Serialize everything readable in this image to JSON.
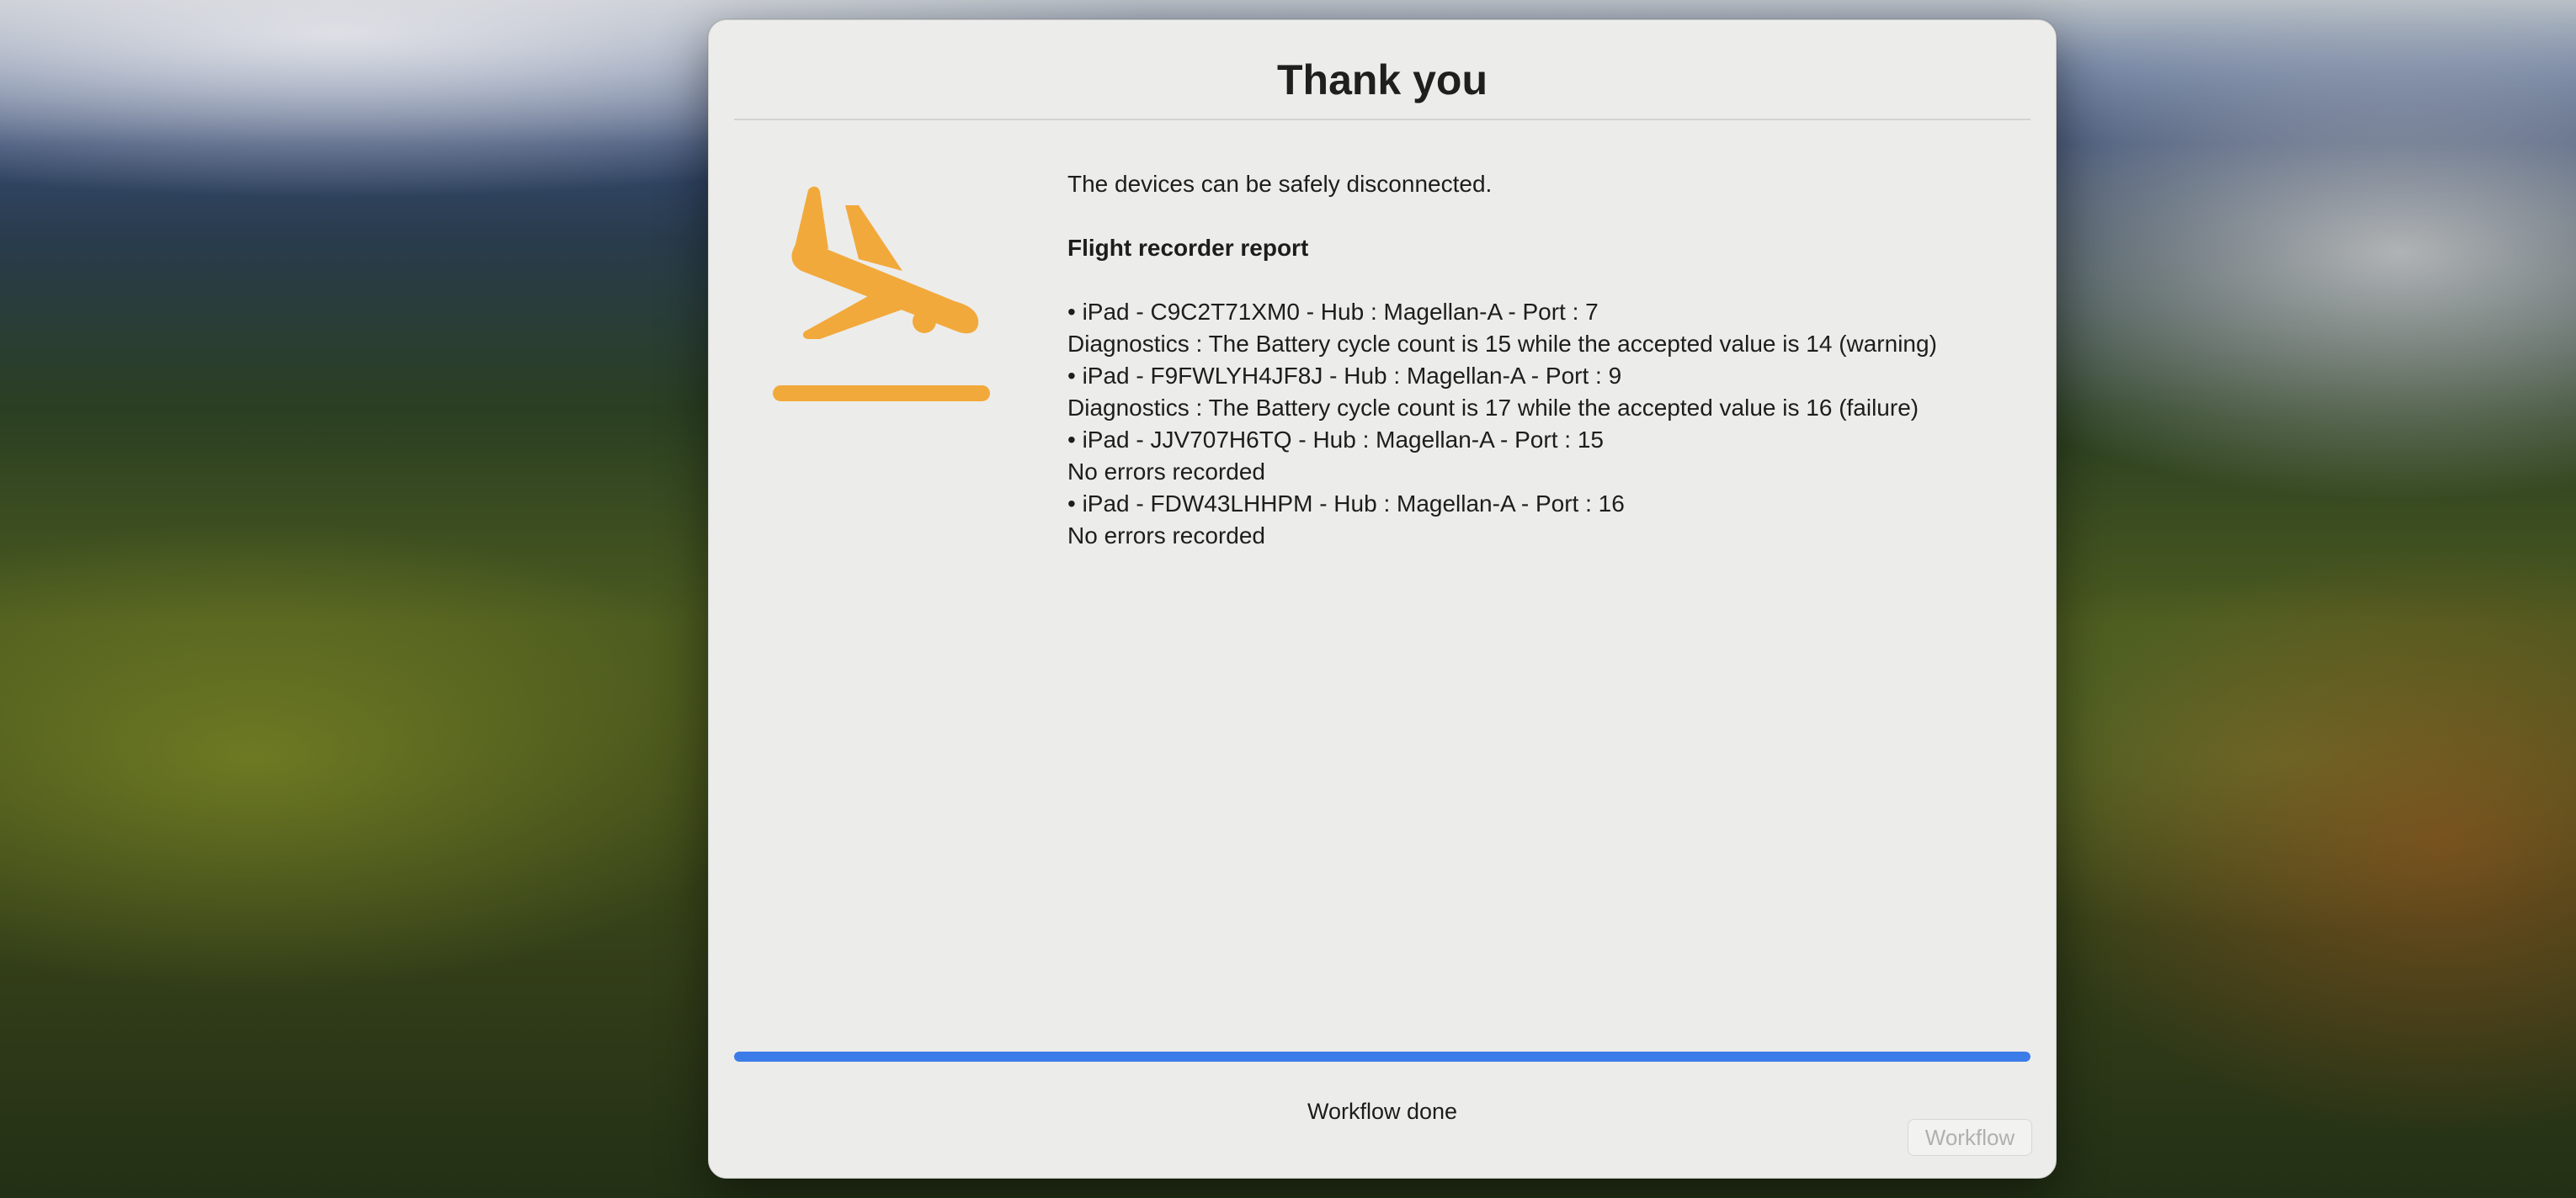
{
  "window": {
    "title": "Thank you"
  },
  "icon": {
    "name": "airplane-arrival-icon",
    "color": "#f2a93b"
  },
  "message": {
    "intro": "The devices can be safely disconnected.",
    "report_heading": "Flight recorder report",
    "entries": [
      {
        "device": "• iPad - C9C2T71XM0 - Hub : Magellan-A - Port : 7",
        "detail": "Diagnostics : The Battery cycle count is 15 while the accepted value is 14 (warning)"
      },
      {
        "device": "• iPad - F9FWLYH4JF8J - Hub : Magellan-A - Port : 9",
        "detail": "Diagnostics : The Battery cycle count is 17 while the accepted value is 16 (failure)"
      },
      {
        "device": "• iPad - JJV707H6TQ - Hub : Magellan-A - Port : 15",
        "detail": "No errors recorded"
      },
      {
        "device": "• iPad - FDW43LHHPM - Hub : Magellan-A - Port : 16",
        "detail": "No errors recorded"
      }
    ]
  },
  "progress": {
    "fraction": 1.0,
    "color": "#3c7ce9",
    "status_text": "Workflow done"
  },
  "footer": {
    "workflow_button_label": "Workflow",
    "workflow_button_enabled": false
  }
}
